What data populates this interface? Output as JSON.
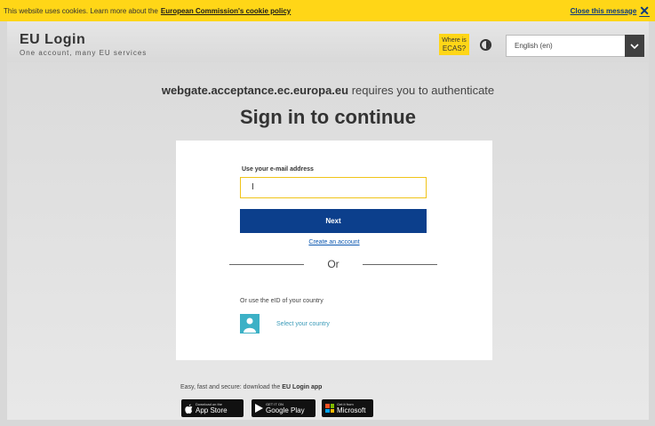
{
  "cookie_banner": {
    "text": "This website uses cookies. Learn more about the",
    "policy_link": "European Commission's cookie policy",
    "close_label": "Close this message",
    "close_glyph": "✕"
  },
  "header": {
    "title": "EU Login",
    "tagline": "One account, many EU services",
    "ecas_line1": "Where is",
    "ecas_line2": "ECAS?",
    "language": "English (en)",
    "language_chevron": "⌄"
  },
  "main": {
    "site": "webgate.acceptance.ec.europa.eu",
    "auth_text": " requires you to authenticate",
    "heading": "Sign in to continue"
  },
  "form": {
    "email_label": "Use your e-mail address",
    "email_value": "I",
    "next_label": "Next",
    "create_account": "Create an account",
    "or_text": "Or",
    "eid_label": "Or use the eID of your country",
    "select_country": "Select your country"
  },
  "apps": {
    "message_prefix": "Easy, fast and secure: download the ",
    "message_app": "EU Login app",
    "app_store_small": "Download on the",
    "app_store": "App Store",
    "google_small": "GET IT ON",
    "google_play": "Google Play",
    "microsoft_small": "Get it from",
    "microsoft": "Microsoft"
  },
  "colors": {
    "banner_yellow": "#ffd617",
    "primary_blue": "#0c3f8c",
    "link_blue": "#0b57b0",
    "teal": "#3cb1c6"
  },
  "icons": [
    "close-icon",
    "contrast-icon",
    "chevron-down-icon",
    "user-icon",
    "apple-icon",
    "google-play-icon",
    "microsoft-icon"
  ]
}
